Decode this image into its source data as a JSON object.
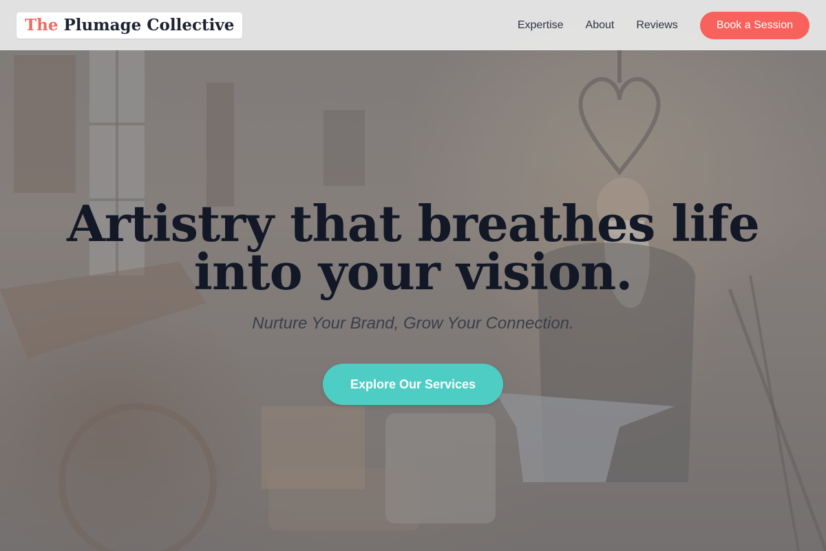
{
  "header": {
    "logo_accent": "The",
    "logo_rest": "Plumage Collective",
    "nav": [
      {
        "label": "Expertise"
      },
      {
        "label": "About"
      },
      {
        "label": "Reviews"
      }
    ],
    "cta_label": "Book a Session"
  },
  "hero": {
    "title_line1": "Artistry that breathes life",
    "title_line2": "into your vision.",
    "subtitle": "Nurture Your Brand, Grow Your Connection.",
    "button_label": "Explore Our Services"
  },
  "colors": {
    "accent_coral": "#f8615c",
    "accent_teal": "#4ecdc4",
    "heading_navy": "#121826"
  },
  "icons": {
    "background": "workshop-photo"
  }
}
